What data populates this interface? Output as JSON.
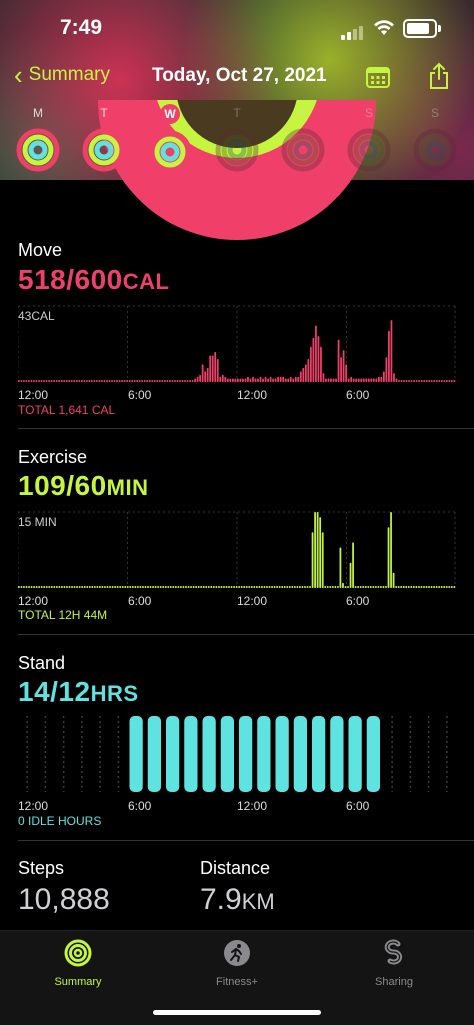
{
  "status_bar": {
    "time": "7:49"
  },
  "nav": {
    "back_label": "Summary",
    "title": "Today, Oct 27, 2021"
  },
  "week": {
    "days": [
      {
        "label": "M",
        "selected": false
      },
      {
        "label": "T",
        "selected": false
      },
      {
        "label": "W",
        "selected": true
      },
      {
        "label": "T",
        "selected": false
      },
      {
        "label": "F",
        "selected": false
      },
      {
        "label": "S",
        "selected": false
      },
      {
        "label": "S",
        "selected": false
      }
    ]
  },
  "move": {
    "title": "Move",
    "value": "518/600",
    "unit": "CAL",
    "scale_label": "43CAL",
    "total": "TOTAL 1,641 CAL",
    "color": "#f0406a"
  },
  "exercise": {
    "title": "Exercise",
    "value": "109/60",
    "unit": "MIN",
    "scale_label": "15 MIN",
    "total": "TOTAL 12H 44M",
    "color": "#c5f53e"
  },
  "stand": {
    "title": "Stand",
    "value": "14/12",
    "unit": "HRS",
    "total": "0 IDLE HOURS",
    "color": "#5ee3e0"
  },
  "time_ticks": [
    "12:00",
    "6:00",
    "12:00",
    "6:00"
  ],
  "steps": {
    "title": "Steps",
    "value": "10,888"
  },
  "distance": {
    "title": "Distance",
    "value": "7.9",
    "unit": "KM"
  },
  "tabs": [
    {
      "label": "Summary",
      "icon": "activity-rings-icon",
      "active": true
    },
    {
      "label": "Fitness+",
      "icon": "runner-icon",
      "active": false
    },
    {
      "label": "Sharing",
      "icon": "sharing-icon",
      "active": false
    }
  ],
  "chart_data": [
    {
      "type": "bar",
      "title": "Move",
      "ylabel": "43CAL",
      "x_ticks": [
        "12:00",
        "6:00",
        "12:00",
        "6:00"
      ],
      "values": [
        0,
        0,
        0,
        0,
        0,
        0,
        0,
        0,
        0,
        0,
        0,
        0,
        0,
        0,
        0,
        0,
        0,
        0,
        0,
        0,
        0,
        0,
        0,
        0,
        0,
        0,
        0,
        0,
        0,
        0,
        0,
        0,
        1,
        1,
        1,
        1,
        1,
        1,
        1,
        1,
        1,
        1,
        1,
        1,
        1,
        1,
        1,
        1,
        1,
        1,
        1,
        1,
        1,
        1,
        1,
        1,
        1,
        1,
        1,
        1,
        1,
        1,
        1,
        1,
        1,
        1,
        1,
        1,
        1,
        1,
        2,
        3,
        4,
        10,
        6,
        8,
        15,
        15,
        17,
        13,
        3,
        4,
        3,
        2,
        2,
        2,
        2,
        2,
        2,
        2,
        2,
        3,
        2,
        3,
        2,
        2,
        3,
        2,
        3,
        2,
        3,
        2,
        2,
        3,
        3,
        3,
        2,
        2,
        3,
        2,
        3,
        3,
        6,
        8,
        10,
        13,
        20,
        25,
        32,
        26,
        20,
        5,
        2,
        2,
        2,
        2,
        2,
        24,
        14,
        18,
        10,
        2,
        3,
        2,
        2,
        2,
        2,
        2,
        2,
        2,
        2,
        2,
        2,
        3,
        3,
        6,
        14,
        29,
        35,
        5,
        2,
        1,
        1,
        1,
        1,
        1,
        1,
        1,
        1,
        1,
        1,
        1,
        1,
        1,
        1,
        1,
        1,
        1,
        1,
        1,
        1,
        1,
        1,
        1
      ],
      "ylim": [
        0,
        43
      ],
      "color": "#f0406a"
    },
    {
      "type": "bar",
      "title": "Exercise",
      "ylabel": "15 MIN",
      "x_ticks": [
        "12:00",
        "6:00",
        "12:00",
        "6:00"
      ],
      "values": [
        0,
        0,
        0,
        0,
        0,
        0,
        0,
        0,
        0,
        0,
        0,
        0,
        0,
        0,
        0,
        0,
        0,
        0,
        0,
        0,
        0,
        0,
        0,
        0,
        0,
        0,
        0,
        0,
        0,
        0,
        0,
        0,
        0,
        0,
        0,
        0,
        0,
        0,
        0,
        0,
        0,
        0,
        0,
        0,
        0,
        0,
        0,
        0,
        0,
        0,
        0,
        0,
        0,
        0,
        0,
        0,
        0,
        0,
        0,
        0,
        0,
        0,
        0,
        0,
        0,
        0,
        0,
        0,
        0,
        0,
        0,
        0,
        0,
        0,
        0,
        0,
        0,
        0,
        0,
        0,
        0,
        0,
        0,
        0,
        0,
        0,
        0,
        0,
        0,
        0,
        0,
        0,
        0,
        0,
        0,
        0,
        0,
        0,
        0,
        0,
        0,
        0,
        0,
        0,
        0,
        0,
        0,
        0,
        0,
        0,
        0,
        0,
        0,
        0,
        0,
        0,
        11,
        15,
        15,
        14,
        11,
        0,
        0,
        0,
        0,
        0,
        0,
        8,
        1,
        0,
        0,
        5,
        9,
        0,
        0,
        0,
        0,
        0,
        0,
        0,
        0,
        0,
        0,
        0,
        0,
        0,
        12,
        15,
        3,
        0,
        0,
        0,
        0,
        0,
        0,
        0,
        0,
        0,
        0,
        0,
        0,
        0,
        0,
        0,
        0,
        0,
        0,
        0,
        0,
        0,
        0,
        0,
        0
      ],
      "ylim": [
        0,
        15
      ],
      "color": "#c5f53e"
    },
    {
      "type": "bar",
      "title": "Stand",
      "x_ticks": [
        "12:00",
        "6:00",
        "12:00",
        "6:00"
      ],
      "values": [
        0,
        0,
        0,
        0,
        0,
        0,
        1,
        1,
        1,
        1,
        1,
        1,
        1,
        1,
        1,
        1,
        1,
        1,
        1,
        1,
        0,
        0,
        0,
        0
      ],
      "ylim": [
        0,
        1
      ],
      "color": "#5ee3e0"
    }
  ]
}
